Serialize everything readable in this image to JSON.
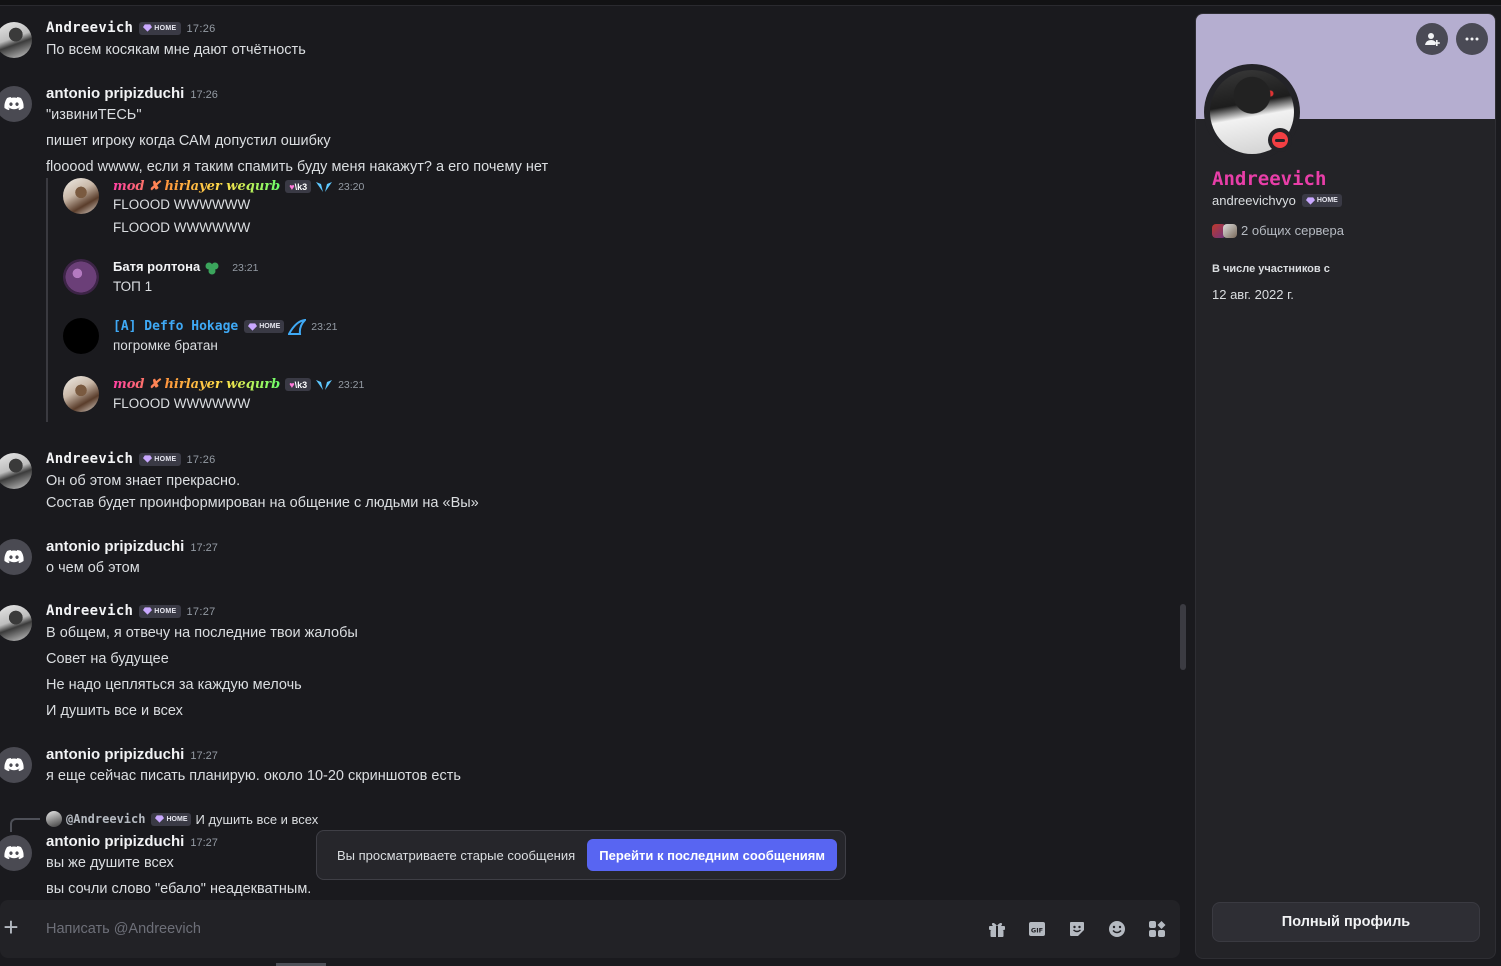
{
  "composer": {
    "placeholder": "Написать @Andreevich"
  },
  "tag_home": "HOME",
  "jump_bar": {
    "text": "Вы просматриваете старые сообщения",
    "button": "Перейти к последним сообщениям"
  },
  "messages": [
    {
      "author": "Andreevich",
      "time": "17:26",
      "lines": [
        "По всем косякам мне дают отчётность"
      ]
    },
    {
      "author": "antonio pripizduchi",
      "time": "17:26",
      "lines": [
        "\"извиниТЕСЬ\"",
        "пишет игроку когда САМ допустил ошибку",
        "flooood wwww, если я таким спамить буду меня накажут? а его почему нет"
      ]
    },
    {
      "author": "Andreevich",
      "time": "17:26",
      "lines": [
        "Он об этом знает прекрасно.",
        "Состав будет проинформирован на общение с людьми на «Вы»"
      ]
    },
    {
      "author": "antonio pripizduchi",
      "time": "17:27",
      "lines": [
        "о чем об этом"
      ]
    },
    {
      "author": "Andreevich",
      "time": "17:27",
      "lines": [
        "В общем, я отвечу на последние твои жалобы",
        "Совет на будущее",
        "Не надо цепляться за каждую мелочь",
        "И душить все и всех"
      ]
    },
    {
      "author": "antonio pripizduchi",
      "time": "17:27",
      "lines": [
        "я еще сейчас писать планирую. около 10-20 скриншотов есть"
      ]
    },
    {
      "author": "antonio pripizduchi",
      "time": "17:27",
      "lines": [
        "вы же душите всех",
        "вы сочли слово \"ебало\" неадекватным."
      ]
    }
  ],
  "forwarded": [
    {
      "author": "mod ✘ hirlayer wequrb",
      "tag": "\\k3",
      "time": "23:20",
      "lines": [
        "FLOOOD WWWWWW",
        "FLOOOD WWWWWW"
      ]
    },
    {
      "author": "Батя ролтона",
      "time": "23:21",
      "lines": [
        "ТОП 1"
      ]
    },
    {
      "author": "[A] Deffo Hokage",
      "time": "23:21",
      "lines": [
        "погромке братан"
      ]
    },
    {
      "author": "mod ✘ hirlayer wequrb",
      "tag": "\\k3",
      "time": "23:21",
      "lines": [
        "FLOOOD WWWWWW"
      ]
    }
  ],
  "reply": {
    "mention": "@Andreevich",
    "text": "И душить все и всех"
  },
  "profile": {
    "display_name": "Andreevich",
    "username": "andreevichvyo",
    "mutual_servers": "2 общих сервера",
    "member_since_label": "В числе участников с",
    "member_since_date": "12 авг. 2022 г.",
    "full_profile_button": "Полный профиль",
    "banner_color": "#b5aed0",
    "name_color": "#e83ea8",
    "status": "do-not-disturb"
  },
  "colors": {
    "accent": "#5865f2",
    "background": "#1a1a1e",
    "dnd": "#f23f43"
  },
  "icons": [
    "plus-icon",
    "gift-icon",
    "gif-icon",
    "sticker-icon",
    "emoji-icon",
    "apps-icon",
    "add-friend-icon",
    "more-icon",
    "discord-icon"
  ]
}
